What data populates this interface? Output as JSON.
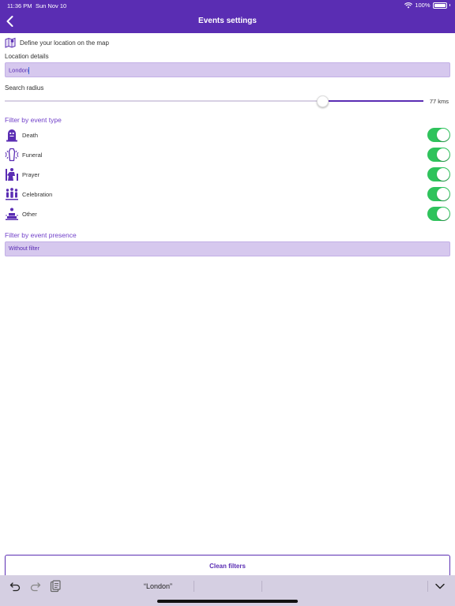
{
  "status_bar": {
    "time": "11:36 PM",
    "date": "Sun Nov 10",
    "battery": "100%"
  },
  "nav": {
    "title": "Events settings",
    "back_icon": "chevron-left-icon"
  },
  "map": {
    "label": "Define your location on the map",
    "icon": "map-icon"
  },
  "location": {
    "label": "Location details",
    "value": "London"
  },
  "radius": {
    "label": "Search radius",
    "value_text": "77 kms",
    "fraction": 0.76
  },
  "event_type": {
    "title": "Filter by event type",
    "items": [
      {
        "label": "Death",
        "icon": "tombstone-icon",
        "on": true
      },
      {
        "label": "Funeral",
        "icon": "coffin-icon",
        "on": true
      },
      {
        "label": "Prayer",
        "icon": "praying-icon",
        "on": true
      },
      {
        "label": "Celebration",
        "icon": "people-icon",
        "on": true
      },
      {
        "label": "Other",
        "icon": "cake-icon",
        "on": true
      }
    ]
  },
  "presence": {
    "title": "Filter by event presence",
    "value": "Without filter"
  },
  "clean_button": "Clean filters",
  "keyboard_bar": {
    "suggestion": "“London”"
  },
  "colors": {
    "brand": "#5a2db3",
    "input_bg": "#d6c8ee",
    "toggle_on": "#2fc35c"
  }
}
